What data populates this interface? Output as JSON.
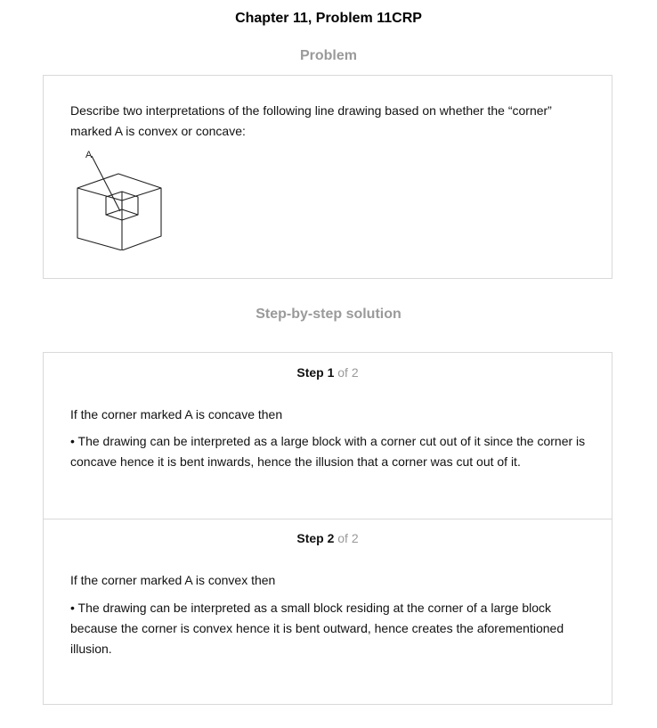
{
  "page": {
    "title": "Chapter 11, Problem 11CRP"
  },
  "problem": {
    "heading": "Problem",
    "text": "Describe two interpretations of the following line drawing based on whether the “corner” marked A is convex or concave:",
    "figure_label": "A"
  },
  "solution": {
    "heading": "Step-by-step solution",
    "steps": [
      {
        "label": "Step 1",
        "of": " of 2",
        "intro": "If the corner marked A is concave then",
        "body": "• The drawing can be interpreted as a large block with a corner cut out of it since the corner is concave hence it is bent inwards, hence the illusion that a corner was cut out of it."
      },
      {
        "label": "Step 2",
        "of": " of 2",
        "intro": "If the corner marked A is convex then",
        "body": "• The drawing can be interpreted as a small block residing at the corner of a large block because the corner is convex hence it is bent outward, hence creates the aforementioned illusion."
      }
    ]
  }
}
